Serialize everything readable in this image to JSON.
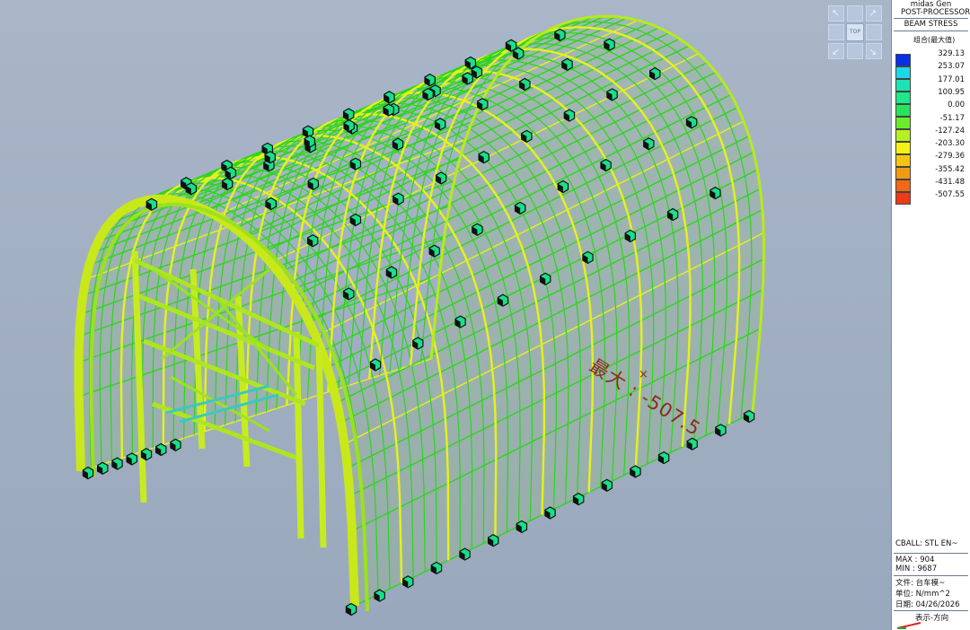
{
  "app": {
    "name": "midas Gen",
    "subtitle": "POST-PROCESSOR",
    "result_type": "BEAM STRESS"
  },
  "legend": {
    "title": "组合(最大值)",
    "values": [
      "329.13",
      "253.07",
      "177.01",
      "100.95",
      "0.00",
      "-51.17",
      "-127.24",
      "-203.30",
      "-279.36",
      "-355.42",
      "-431.48",
      "-507.55"
    ],
    "colors": [
      "#0a2ee6",
      "#19d8e8",
      "#1de3b4",
      "#1ee88a",
      "#27e35a",
      "#6bec2a",
      "#b5f020",
      "#f4f211",
      "#f6c514",
      "#f29a14",
      "#f26818",
      "#ee3a16"
    ]
  },
  "info": {
    "load_case": "CBALL: STL EN~",
    "max": "MAX : 904",
    "min": "MIN : 9687",
    "file": "文件: 台车模~",
    "unit": "单位: N/mm^2",
    "date": "日期: 04/26/2026",
    "view_dir": "表示-方向"
  },
  "annotation": {
    "max_label": "最大 : -507.5"
  },
  "viewcube": {
    "top_label": "TOP"
  },
  "colors": {
    "mesh_green": "#2bd61a",
    "mesh_yellow": "#e4f21c",
    "support_fill": "#18e08a",
    "background": "#a9b6c8"
  }
}
